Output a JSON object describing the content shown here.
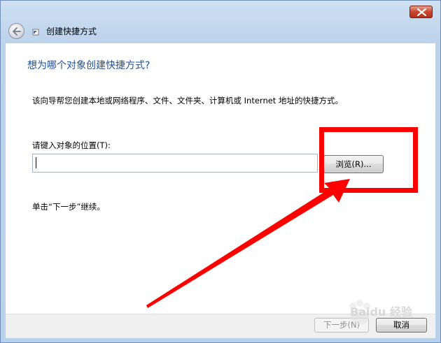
{
  "window": {
    "title": "创建快捷方式",
    "close_icon": "close-icon",
    "back_icon": "back-arrow-icon"
  },
  "wizard": {
    "heading": "想为哪个对象创建快捷方式?",
    "description": "该向导帮您创建本地或网络程序、文件、文件夹、计算机或 Internet 地址的快捷方式。",
    "field_label": "请键入对象的位置(T):",
    "field_value": "",
    "browse_label": "浏览(R)...",
    "hint": "单击“下一步”继续。"
  },
  "footer": {
    "next_label": "下一步(N)",
    "cancel_label": "取消"
  },
  "colors": {
    "annotation": "#ff0000",
    "heading": "#1f4e99"
  },
  "watermark": {
    "text": "Baidu 经验"
  }
}
